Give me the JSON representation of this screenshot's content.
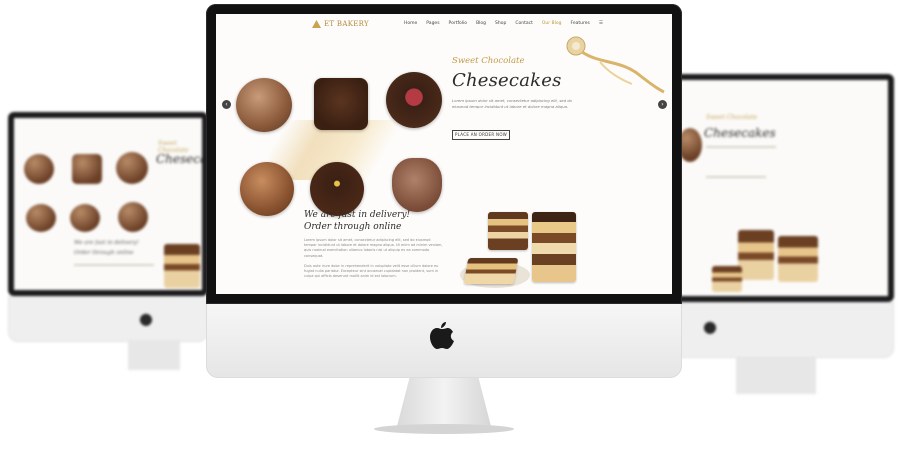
{
  "site": {
    "logo_text": "ET BAKERY",
    "menu": [
      "Home",
      "Pages",
      "Portfolio",
      "Blog",
      "Shop",
      "Contact",
      "Our Blog",
      "Features"
    ],
    "hero": {
      "subtitle": "Sweet Chocolate",
      "title": "Chesecakes",
      "description": "Lorem ipsum dolor sit amet, consectetur adipiscing elit, sed do eiusmod tempor incididunt ut labore et dolore magna aliqua.",
      "button_label": "PLACE AN ORDER NOW"
    },
    "delivery": {
      "title_line1": "We are fast in delivery!",
      "title_line2": "Order through online",
      "paragraph1": "Lorem ipsum dolor sit amet, consectetur adipiscing elit, sed do eiusmod tempor incididunt ut labore et dolore magna aliqua. Ut enim ad minim veniam, quis nostrud exercitation ullamco laboris nisi ut aliquip ex ea commodo consequat.",
      "paragraph2": "Duis aute irure dolor in reprehenderit in voluptate velit esse cillum dolore eu fugiat nulla pariatur. Excepteur sint occaecat cupidatat non proident, sunt in culpa qui officia deserunt mollit anim id est laborum."
    }
  },
  "left_monitor": {
    "hero_title": "Chesecakes",
    "subtitle": "Sweet Chocolate",
    "delivery_line1": "We are fast in delivery!",
    "delivery_line2": "Order through online"
  },
  "right_monitor": {
    "hero_title": "Chesecakes",
    "subtitle": "Sweet Chocolate"
  },
  "colors": {
    "accent_gold": "#c19a49",
    "heading_dark": "#2f2b29",
    "frame_black": "#111112"
  },
  "icons": [
    "apple-logo-icon",
    "slider-prev-icon",
    "slider-next-icon",
    "cart-icon"
  ]
}
